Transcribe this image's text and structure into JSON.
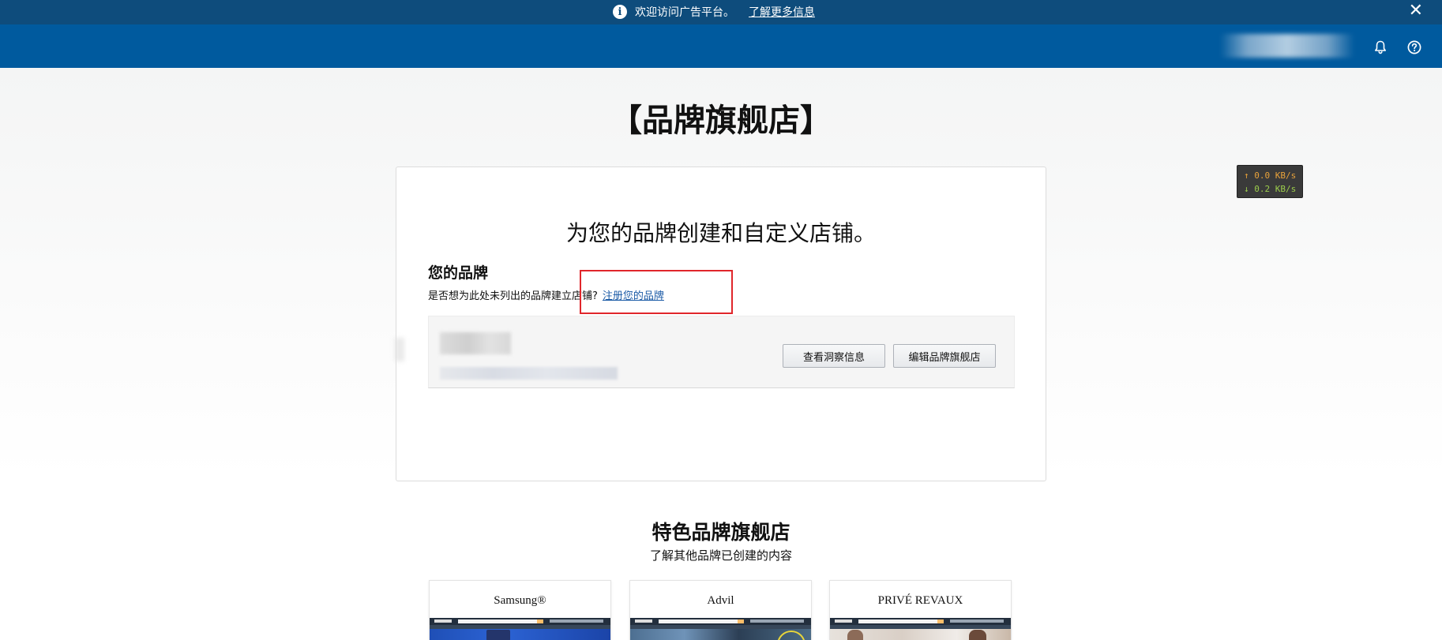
{
  "notice": {
    "text": "欢迎访问广告平台。",
    "link": "了解更多信息",
    "close": "✕"
  },
  "header": {
    "icons": [
      "bell-icon",
      "help-icon"
    ]
  },
  "page": {
    "title": "【品牌旗舰店】"
  },
  "network_widget": {
    "upload": "↑ 0.0 KB/s",
    "download": "↓ 0.2 KB/s"
  },
  "brand_card": {
    "heading": "为您的品牌创建和自定义店铺。",
    "your_brand": "您的品牌",
    "prompt": "是否想为此处未列出的品牌建立店铺?",
    "register_link": "注册您的品牌",
    "insights_button": "查看洞察信息",
    "edit_button": "编辑品牌旗舰店"
  },
  "featured": {
    "title": "特色品牌旗舰店",
    "subtitle": "了解其他品牌已创建的内容",
    "stores": [
      {
        "name": "Samsung®"
      },
      {
        "name": "Advil"
      },
      {
        "name": "PRIVÉ REVAUX"
      }
    ]
  },
  "colors": {
    "notice_bg": "#0e4c7c",
    "header_bg": "#005a9e",
    "link": "#1a5aa6",
    "highlight": "#e0262b"
  }
}
